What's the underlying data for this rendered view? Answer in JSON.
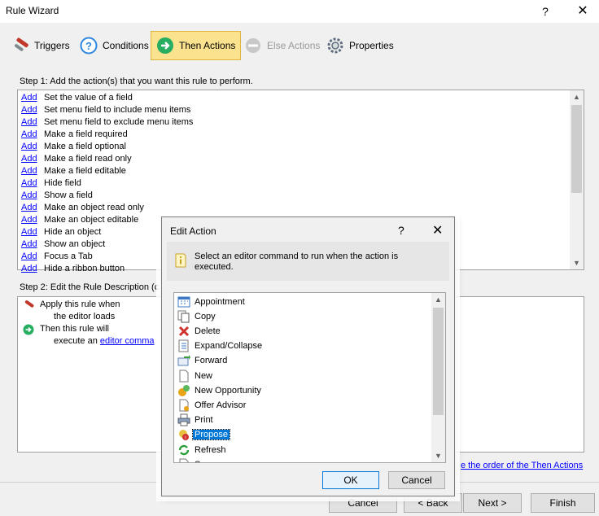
{
  "window": {
    "title": "Rule Wizard",
    "help_glyph": "?",
    "close_glyph": "✕"
  },
  "toolbar": {
    "tabs": [
      {
        "label": "Triggers",
        "icon": "triggers-icon",
        "state": "normal"
      },
      {
        "label": "Conditions",
        "icon": "question-icon",
        "state": "normal"
      },
      {
        "label": "Then Actions",
        "icon": "arrow-right-icon",
        "state": "active"
      },
      {
        "label": "Else Actions",
        "icon": "no-entry-icon",
        "state": "disabled"
      },
      {
        "label": "Properties",
        "icon": "gear-icon",
        "state": "normal"
      }
    ]
  },
  "step1": {
    "label": "Step 1:  Add the action(s) that you want this rule to perform.",
    "add_label": "Add",
    "actions": [
      "Set the value of a field",
      "Set menu field to include menu items",
      "Set menu field to exclude menu items",
      "Make a field required",
      "Make a field optional",
      "Make a field read only",
      "Make a field editable",
      "Hide field",
      "Show a field",
      "Make an object read only",
      "Make an object editable",
      "Hide an object",
      "Show an object",
      "Focus a Tab",
      "Hide a ribbon button"
    ]
  },
  "step2": {
    "label": "Step 2:  Edit the Rule Description (c",
    "lines": {
      "apply": "Apply this rule when",
      "editor_loads": "the editor loads",
      "then": "Then this rule will",
      "execute_prefix": "execute an",
      "execute_link": "editor comma"
    },
    "order_link": "e the order of the Then Actions"
  },
  "footer": {
    "cancel": "Cancel",
    "back": "< Back",
    "next": "Next >",
    "finish": "Finish"
  },
  "modal": {
    "title": "Edit Action",
    "help_glyph": "?",
    "close_glyph": "✕",
    "info_text": "Select an editor command to run when the action is executed.",
    "commands": [
      {
        "label": "Appointment",
        "icon": "calendar-icon"
      },
      {
        "label": "Copy",
        "icon": "copy-icon"
      },
      {
        "label": "Delete",
        "icon": "delete-x-icon"
      },
      {
        "label": "Expand/Collapse",
        "icon": "expand-collapse-icon"
      },
      {
        "label": "Forward",
        "icon": "forward-icon"
      },
      {
        "label": "New",
        "icon": "new-document-icon"
      },
      {
        "label": "New Opportunity",
        "icon": "new-opportunity-icon"
      },
      {
        "label": "Offer Advisor",
        "icon": "offer-advisor-icon"
      },
      {
        "label": "Print",
        "icon": "printer-icon"
      },
      {
        "label": "Propose",
        "icon": "propose-icon"
      },
      {
        "label": "Refresh",
        "icon": "refresh-icon"
      },
      {
        "label": "S",
        "icon": "document-icon"
      }
    ],
    "selected_command": "Propose",
    "ok": "OK",
    "cancel": "Cancel"
  },
  "colors": {
    "active_tab": "#fbe28f",
    "link": "#0000ff",
    "selection": "#0078d7"
  }
}
